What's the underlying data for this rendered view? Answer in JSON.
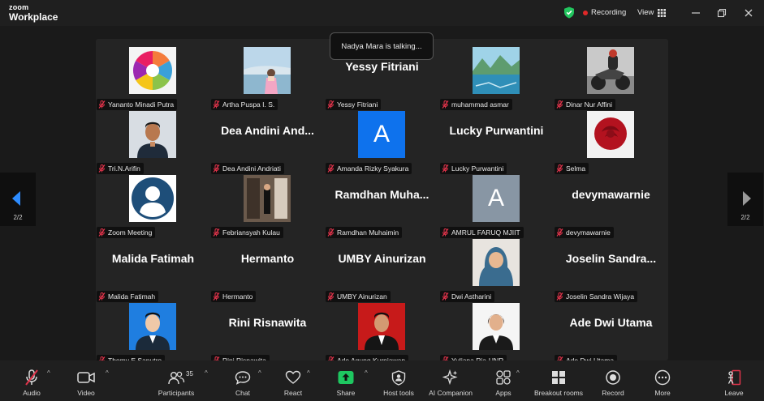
{
  "app": {
    "logo_line1": "zoom",
    "logo_line2": "Workplace"
  },
  "titlebar": {
    "recording_label": "Recording",
    "view_label": "View"
  },
  "talking_indicator": "Nadya Mara is talking...",
  "nav": {
    "left_page": "2/2",
    "right_page": "2/2"
  },
  "participants_tiles": [
    {
      "name": "Yananto Minadi Putra",
      "kind": "image",
      "scene": "wheel"
    },
    {
      "name": "Artha Puspa I. S.",
      "kind": "image",
      "scene": "beach"
    },
    {
      "name": "Yessy Fitriani",
      "kind": "text",
      "display": "Yessy Fitriani"
    },
    {
      "name": "muhammad asmar",
      "kind": "image",
      "scene": "lake"
    },
    {
      "name": "Dinar Nur Affini",
      "kind": "image",
      "scene": "moto"
    },
    {
      "name": "Tri.N.Arifin",
      "kind": "image",
      "scene": "man-dark"
    },
    {
      "name": "Dea Andini Andriati",
      "kind": "text",
      "display": "Dea Andini And..."
    },
    {
      "name": "Amanda Rizky Syakura",
      "kind": "letter",
      "letter": "A",
      "color": "#0e72ed"
    },
    {
      "name": "Lucky Purwantini",
      "kind": "text",
      "display": "Lucky Purwantini"
    },
    {
      "name": "Selma",
      "kind": "image",
      "scene": "rose"
    },
    {
      "name": "Zoom Meeting",
      "kind": "image",
      "scene": "avatar"
    },
    {
      "name": "Febriansyah Kulau",
      "kind": "image",
      "scene": "room"
    },
    {
      "name": "Ramdhan Muhaimin",
      "kind": "text",
      "display": "Ramdhan Muha..."
    },
    {
      "name": "AMRUL FARUQ MJIIT",
      "kind": "letter",
      "letter": "A",
      "color": "#8896a4"
    },
    {
      "name": "devymawarnie",
      "kind": "text",
      "display": "devymawarnie"
    },
    {
      "name": "Malida Fatimah",
      "kind": "text",
      "display": "Malida Fatimah"
    },
    {
      "name": "Hermanto",
      "kind": "text",
      "display": "Hermanto"
    },
    {
      "name": "UMBY Ainurizan",
      "kind": "text",
      "display": "UMBY Ainurizan"
    },
    {
      "name": "Dwi Astharini",
      "kind": "image",
      "scene": "hijab"
    },
    {
      "name": "Joselin Sandra Wijaya",
      "kind": "text",
      "display": "Joselin Sandra..."
    },
    {
      "name": "Thomy E Saputro",
      "kind": "image",
      "scene": "suit-blue"
    },
    {
      "name": "Rini Risnawita",
      "kind": "text",
      "display": "Rini Risnawita"
    },
    {
      "name": "Ade Agung Kurniawan",
      "kind": "image",
      "scene": "suit-red"
    },
    {
      "name": "Yuliana Ria-UNR",
      "kind": "image",
      "scene": "suit-white"
    },
    {
      "name": "Ade Dwi Utama",
      "kind": "text",
      "display": "Ade Dwi Utama"
    }
  ],
  "toolbar": {
    "audio": "Audio",
    "video": "Video",
    "participants": "Participants",
    "participants_count": "35",
    "chat": "Chat",
    "react": "React",
    "share": "Share",
    "host_tools": "Host tools",
    "ai_companion": "AI Companion",
    "apps": "Apps",
    "breakout_rooms": "Breakout rooms",
    "record": "Record",
    "more": "More",
    "leave": "Leave"
  },
  "colors": {
    "share_green": "#1ec760",
    "leave_red": "#e0334a",
    "recording_red": "#e02828",
    "shield_green": "#22c55e"
  }
}
